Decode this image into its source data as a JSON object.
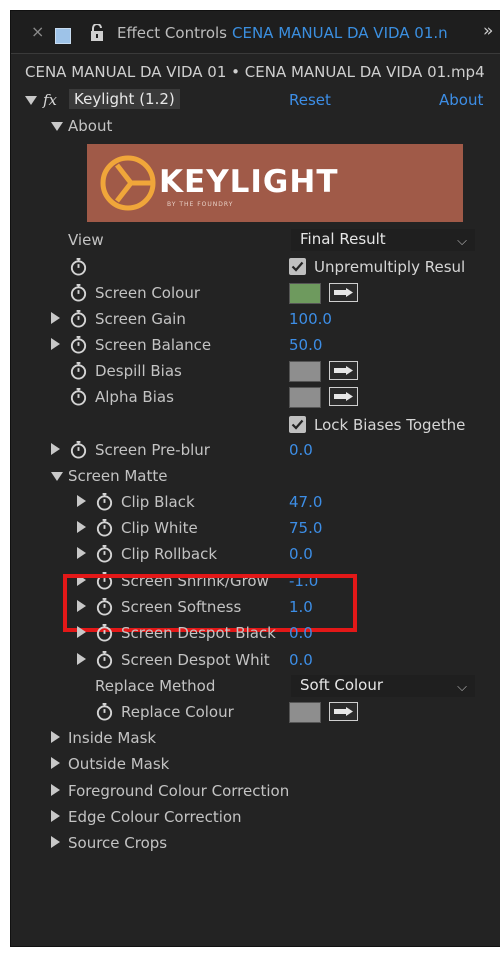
{
  "panel": {
    "tab_close": "×",
    "tab_title": "Effect Controls",
    "tab_comp": "CENA MANUAL DA VIDA 01.n",
    "tab_more": "»",
    "path": "CENA MANUAL DA VIDA 01 • CENA MANUAL DA VIDA 01.mp4"
  },
  "effect": {
    "fx_label": "fx",
    "name": "Keylight (1.2)",
    "reset": "Reset",
    "about": "About"
  },
  "about_group": {
    "label": "About",
    "logo_text": "KEYLIGHT",
    "logo_sub": "BY THE FOUNDRY"
  },
  "params": {
    "view": {
      "label": "View",
      "value": "Final Result"
    },
    "unpremultiply": {
      "label": "Unpremultiply Resul",
      "checked": true
    },
    "screen_colour": {
      "label": "Screen Colour",
      "color": "#6e9a5e"
    },
    "screen_gain": {
      "label": "Screen Gain",
      "value": "100.0"
    },
    "screen_balance": {
      "label": "Screen Balance",
      "value": "50.0"
    },
    "despill_bias": {
      "label": "Despill Bias",
      "color": "#8e8e8e"
    },
    "alpha_bias": {
      "label": "Alpha Bias",
      "color": "#8e8e8e"
    },
    "lock_biases": {
      "label": "Lock Biases Togethe",
      "checked": true
    },
    "screen_preblur": {
      "label": "Screen Pre-blur",
      "value": "0.0"
    },
    "screen_matte": {
      "label": "Screen Matte"
    },
    "clip_black": {
      "label": "Clip Black",
      "value": "47.0"
    },
    "clip_white": {
      "label": "Clip White",
      "value": "75.0"
    },
    "clip_rollback": {
      "label": "Clip Rollback",
      "value": "0.0"
    },
    "screen_shrink_grow": {
      "label": "Screen Shrink/Grow",
      "value": "-1.0"
    },
    "screen_softness": {
      "label": "Screen Softness",
      "value": "1.0"
    },
    "screen_despot_black": {
      "label": "Screen Despot Black",
      "value": "0.0"
    },
    "screen_despot_white": {
      "label": "Screen Despot Whit",
      "value": "0.0"
    },
    "replace_method": {
      "label": "Replace Method",
      "value": "Soft Colour"
    },
    "replace_colour": {
      "label": "Replace Colour",
      "color": "#8e8e8e"
    }
  },
  "groups": {
    "inside_mask": "Inside Mask",
    "outside_mask": "Outside Mask",
    "foreground_cc": "Foreground Colour Correction",
    "edge_cc": "Edge Colour Correction",
    "source_crops": "Source Crops"
  },
  "colors": {
    "accent_blue": "#3d8ee6",
    "highlight_red": "#e31818",
    "banner": "#a05a48",
    "logo_orange": "#f0a63a"
  }
}
